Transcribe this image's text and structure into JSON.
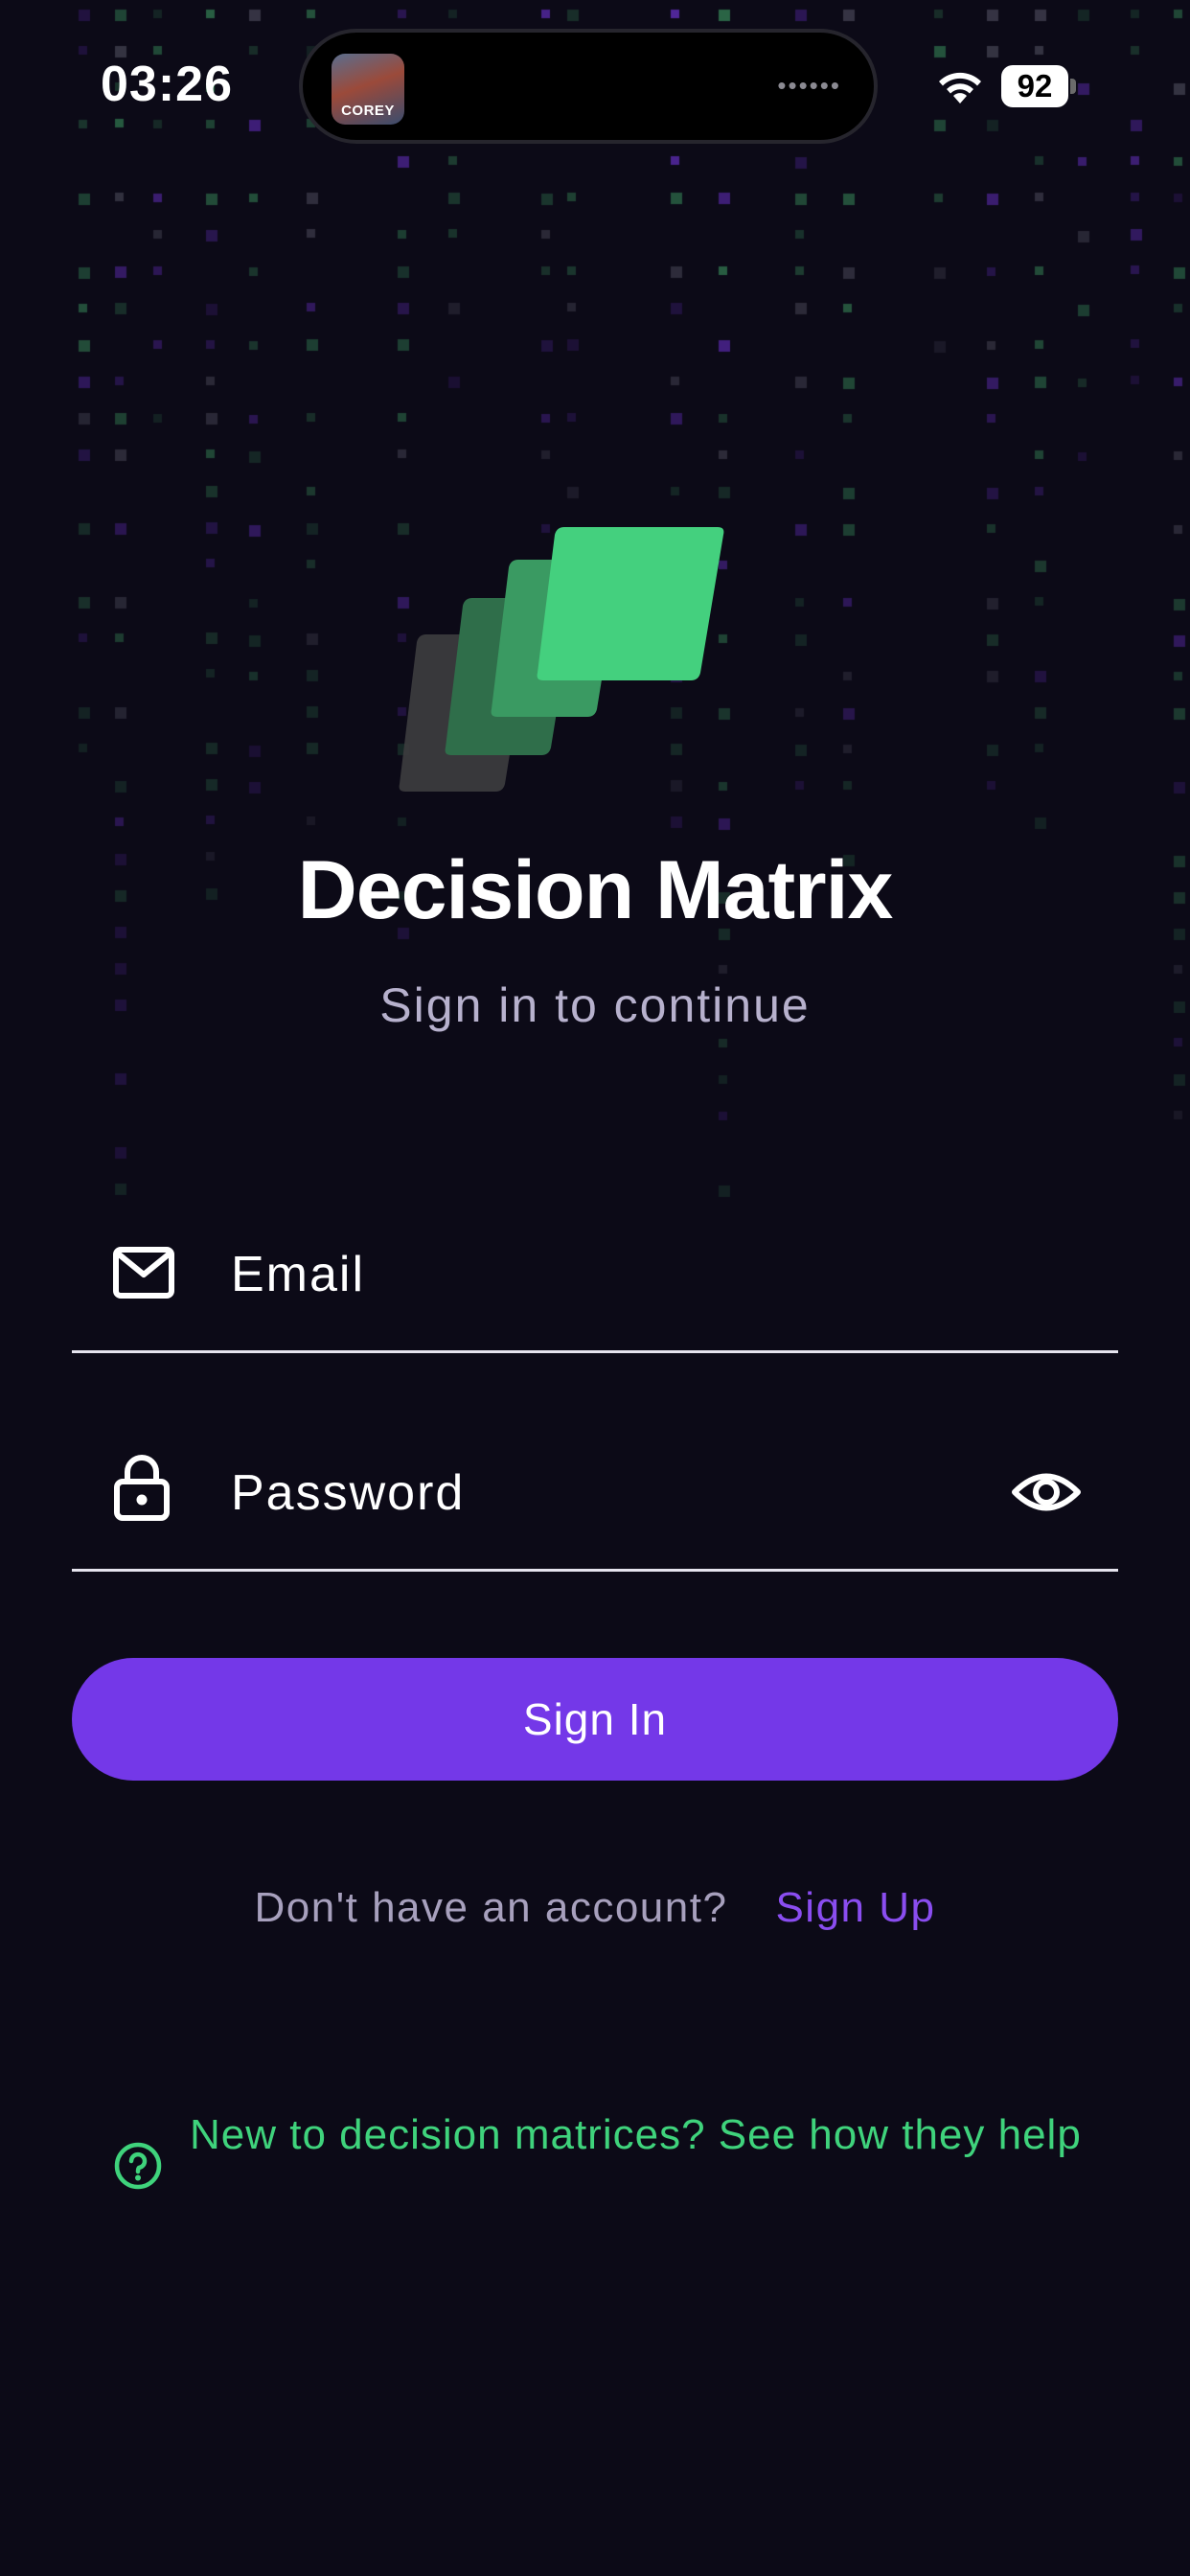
{
  "status_bar": {
    "time": "03:26",
    "battery": "92",
    "island_art_label": "COREY",
    "island_dots": "••••••"
  },
  "app": {
    "title": "Decision Matrix",
    "subtitle": "Sign in to continue"
  },
  "form": {
    "email_placeholder": "Email",
    "password_placeholder": "Password",
    "sign_in_label": "Sign In"
  },
  "signup": {
    "prompt": "Don't have an account?",
    "link": "Sign Up"
  },
  "help": {
    "text": "New to decision matrices? See how they help"
  },
  "colors": {
    "background": "#0c0a17",
    "accent_purple": "#7438e8",
    "accent_green": "#3fd37c",
    "muted_text": "#a7a0bd"
  },
  "icons": {
    "email": "envelope-icon",
    "password": "lock-icon",
    "visibility": "eye-icon",
    "help": "question-circle-icon"
  }
}
